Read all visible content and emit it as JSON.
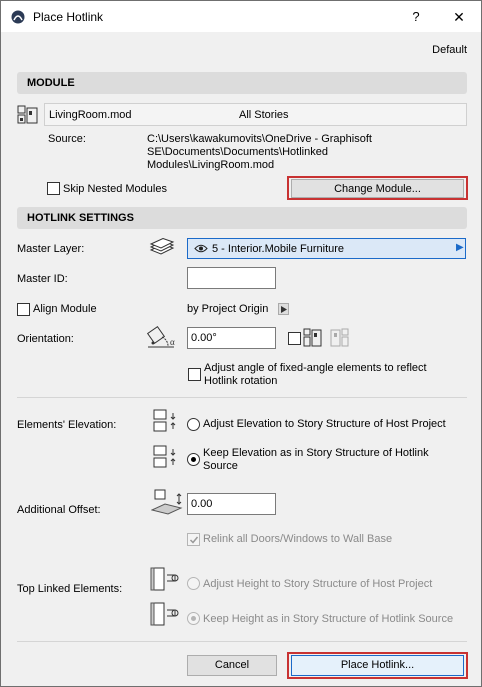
{
  "window": {
    "title": "Place Hotlink",
    "help_glyph": "?",
    "close_glyph": "✕"
  },
  "preset": "Default",
  "module": {
    "section_title": "MODULE",
    "file_name": "LivingRoom.mod",
    "stories": "All Stories",
    "source_label": "Source:",
    "source_lines": [
      "C:\\Users\\kawakumovits\\OneDrive - Graphisoft",
      "SE\\Documents\\Documents\\Hotlinked",
      "Modules\\LivingRoom.mod"
    ],
    "skip_nested_label": "Skip Nested Modules",
    "skip_nested_checked": false,
    "change_module_label": "Change Module..."
  },
  "hotlink": {
    "section_title": "HOTLINK SETTINGS",
    "master_layer_label": "Master Layer:",
    "master_layer_value": "5 - Interior.Mobile Furniture",
    "master_id_label": "Master ID:",
    "master_id_value": "",
    "align_module_label": "Align Module",
    "align_module_checked": false,
    "align_by_label": "by Project Origin",
    "orientation_label": "Orientation:",
    "orientation_value": "0.00°",
    "adjust_angle_label_line1": "Adjust angle of fixed-angle elements to reflect",
    "adjust_angle_label_line2": "Hotlink rotation",
    "adjust_angle_checked": false
  },
  "elevation": {
    "label": "Elements' Elevation:",
    "option_adjust": "Adjust Elevation to Story Structure of Host Project",
    "option_keep_line1": "Keep Elevation as in Story Structure of Hotlink",
    "option_keep_line2": "Source",
    "selected": "keep"
  },
  "offset": {
    "label": "Additional Offset:",
    "value": "0.00",
    "relink_label": "Relink all Doors/Windows to Wall Base",
    "relink_checked": true
  },
  "top_linked": {
    "label": "Top Linked Elements:",
    "option_adjust": "Adjust Height to Story Structure of Host Project",
    "option_keep": "Keep Height as in Story Structure of Hotlink Source",
    "selected": "keep"
  },
  "buttons": {
    "cancel": "Cancel",
    "place": "Place Hotlink..."
  },
  "colors": {
    "highlight_red": "#c83232",
    "selection_blue": "#1b6ac9",
    "section_gray": "#dcdcdc"
  }
}
